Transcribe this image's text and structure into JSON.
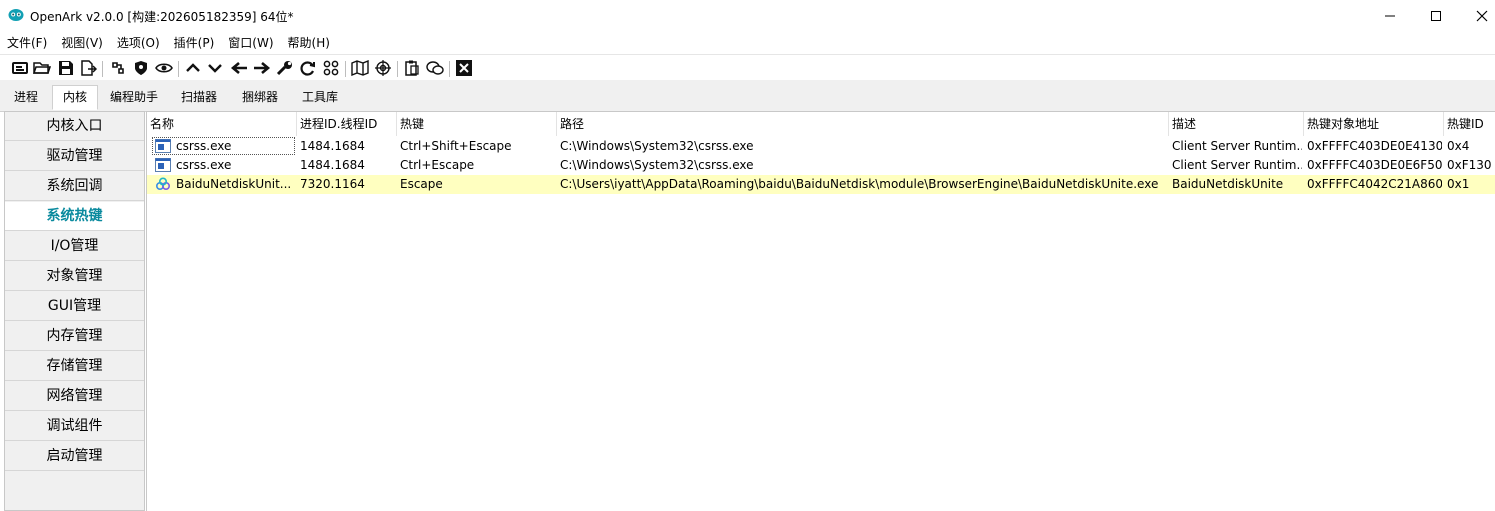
{
  "window": {
    "title": "OpenArk v2.0.0 [构建:202605182359]  64位*",
    "controls": [
      "minimize-icon",
      "maximize-icon",
      "close-icon"
    ]
  },
  "menu": [
    "文件(F)",
    "视图(V)",
    "选项(O)",
    "插件(P)",
    "窗口(W)",
    "帮助(H)"
  ],
  "toolbar_icons": [
    "console-icon",
    "open-folder-icon",
    "save-icon",
    "export-icon",
    "link-icon",
    "shield-icon",
    "eye-icon",
    "arrow-up-icon",
    "arrow-down-icon",
    "arrow-left-icon",
    "arrow-right-icon",
    "wrench-icon",
    "refresh-icon",
    "grid-icon",
    "map-icon",
    "target-icon",
    "clipboard-icon",
    "chat-icon",
    "close-box-icon"
  ],
  "tabs": [
    {
      "label": "进程",
      "active": false
    },
    {
      "label": "内核",
      "active": true
    },
    {
      "label": "编程助手",
      "active": false
    },
    {
      "label": "扫描器",
      "active": false
    },
    {
      "label": "捆绑器",
      "active": false
    },
    {
      "label": "工具库",
      "active": false
    }
  ],
  "sidebar": {
    "items": [
      {
        "label": "内核入口"
      },
      {
        "label": "驱动管理"
      },
      {
        "label": "系统回调"
      },
      {
        "label": "系统热键",
        "active": true
      },
      {
        "label": "I/O管理"
      },
      {
        "label": "对象管理"
      },
      {
        "label": "GUI管理"
      },
      {
        "label": "内存管理"
      },
      {
        "label": "存储管理"
      },
      {
        "label": "网络管理"
      },
      {
        "label": "调试组件"
      },
      {
        "label": "启动管理"
      }
    ]
  },
  "table": {
    "columns": [
      "名称",
      "进程ID.线程ID",
      "热键",
      "路径",
      "描述",
      "热键对象地址",
      "热键ID"
    ],
    "rows": [
      {
        "icon": "window-icon",
        "name": "csrss.exe",
        "pid_tid": "1484.1684",
        "hotkey": "Ctrl+Shift+Escape",
        "path": "C:\\Windows\\System32\\csrss.exe",
        "desc": "Client Server Runtim...",
        "addr": "0xFFFFC403DE0E4130",
        "id": "0x4"
      },
      {
        "icon": "window-icon",
        "name": "csrss.exe",
        "pid_tid": "1484.1684",
        "hotkey": "Ctrl+Escape",
        "path": "C:\\Windows\\System32\\csrss.exe",
        "desc": "Client Server Runtim...",
        "addr": "0xFFFFC403DE0E6F50",
        "id": "0xF130"
      },
      {
        "icon": "baidu-netdisk-icon",
        "name": "BaiduNetdiskUnit...",
        "pid_tid": "7320.1164",
        "hotkey": "Escape",
        "path": "C:\\Users\\iyatt\\AppData\\Roaming\\baidu\\BaiduNetdisk\\module\\BrowserEngine\\BaiduNetdiskUnite.exe",
        "desc": "BaiduNetdiskUnite",
        "addr": "0xFFFFC4042C21A860",
        "id": "0x1",
        "highlighted": true
      }
    ]
  }
}
